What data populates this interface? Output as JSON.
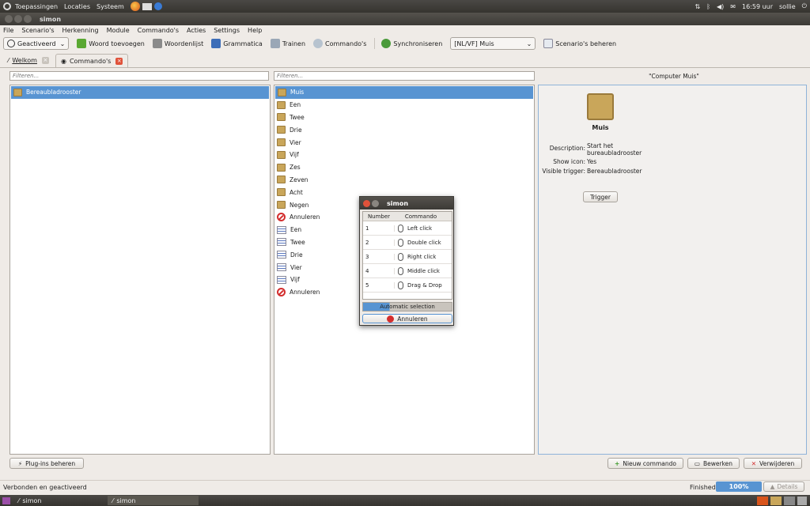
{
  "top_panel": {
    "menus": [
      "Toepassingen",
      "Locaties",
      "Systeem"
    ],
    "clock": "16:59 uur",
    "user": "sollie"
  },
  "window": {
    "title": "simon"
  },
  "menubar": [
    "File",
    "Scenario's",
    "Herkenning",
    "Module",
    "Commando's",
    "Acties",
    "Settings",
    "Help"
  ],
  "toolbar": {
    "activated": "Geactiveerd",
    "add_word": "Woord toevoegen",
    "wordlist": "Woordenlijst",
    "grammar": "Grammatica",
    "train": "Trainen",
    "commands": "Commando's",
    "sync": "Synchroniseren",
    "scenario_select": "[NL/VF] Muis",
    "manage_scenarios": "Scenario's beheren"
  },
  "tabs": [
    {
      "label": "Welkom"
    },
    {
      "label": "Commando's"
    }
  ],
  "filters": {
    "placeholder": "Filteren..."
  },
  "left_list": [
    "Bereaubladrooster"
  ],
  "middle_list": [
    {
      "label": "Muis",
      "icon": "folder-icon"
    },
    {
      "label": "Een",
      "icon": "folder-icon"
    },
    {
      "label": "Twee",
      "icon": "folder-icon"
    },
    {
      "label": "Drie",
      "icon": "folder-icon"
    },
    {
      "label": "Vier",
      "icon": "folder-icon"
    },
    {
      "label": "Vijf",
      "icon": "folder-icon"
    },
    {
      "label": "Zes",
      "icon": "folder-icon"
    },
    {
      "label": "Zeven",
      "icon": "folder-icon"
    },
    {
      "label": "Acht",
      "icon": "folder-icon"
    },
    {
      "label": "Negen",
      "icon": "folder-icon"
    },
    {
      "label": "Annuleren",
      "icon": "cancel-icon"
    },
    {
      "label": "Een",
      "icon": "list-icon"
    },
    {
      "label": "Twee",
      "icon": "list-icon"
    },
    {
      "label": "Drie",
      "icon": "list-icon"
    },
    {
      "label": "Vier",
      "icon": "list-icon"
    },
    {
      "label": "Vijf",
      "icon": "list-icon"
    },
    {
      "label": "Annuleren",
      "icon": "cancel-icon"
    }
  ],
  "details": {
    "header": "\"Computer Muis\"",
    "name": "Muis",
    "description_label": "Description:",
    "description_value_1": "Start het",
    "description_value_2": "bureaubladrooster",
    "show_icon_label": "Show icon:",
    "show_icon_value": "Yes",
    "visible_trigger_label": "Visible trigger:",
    "visible_trigger_value": "Bereaubladrooster",
    "trigger_button": "Trigger"
  },
  "bottom_buttons": {
    "plugins": "Plug-ins beheren",
    "new_command": "Nieuw commando",
    "edit": "Bewerken",
    "delete": "Verwijderen"
  },
  "status": {
    "text": "Verbonden en geactiveerd",
    "finished": "Finished",
    "progress_percent": 100,
    "progress_label": "100%",
    "details": "Details"
  },
  "taskbar": [
    "simon",
    "simon"
  ],
  "dialog": {
    "title": "simon",
    "col_number": "Number",
    "col_command": "Commando",
    "rows": [
      {
        "number": "1",
        "command": "Left click"
      },
      {
        "number": "2",
        "command": "Double click"
      },
      {
        "number": "3",
        "command": "Right click"
      },
      {
        "number": "4",
        "command": "Middle click"
      },
      {
        "number": "5",
        "command": "Drag & Drop"
      }
    ],
    "auto_selection": "Automatic selection",
    "cancel": "Annuleren"
  },
  "colors": {
    "selection": "#5894d2",
    "panel": "#3c3a36"
  }
}
